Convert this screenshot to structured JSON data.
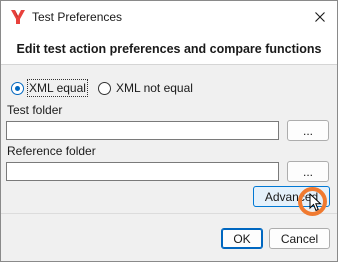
{
  "window": {
    "title": "Test Preferences",
    "icon": "app-logo-icon",
    "close_icon": "close-icon"
  },
  "header": {
    "text": "Edit test action preferences and compare functions"
  },
  "options": {
    "xml_equal": {
      "label": "XML equal",
      "selected": true
    },
    "xml_not_equal": {
      "label": "XML not equal",
      "selected": false
    }
  },
  "test_folder": {
    "label": "Test folder",
    "value": "",
    "browse_label": "..."
  },
  "reference_folder": {
    "label": "Reference folder",
    "value": "",
    "browse_label": "..."
  },
  "buttons": {
    "advanced": "Advanced",
    "ok": "OK",
    "cancel": "Cancel"
  },
  "colors": {
    "accent": "#0067c0",
    "logo": "#e8413c",
    "highlight": "#f07a30"
  }
}
